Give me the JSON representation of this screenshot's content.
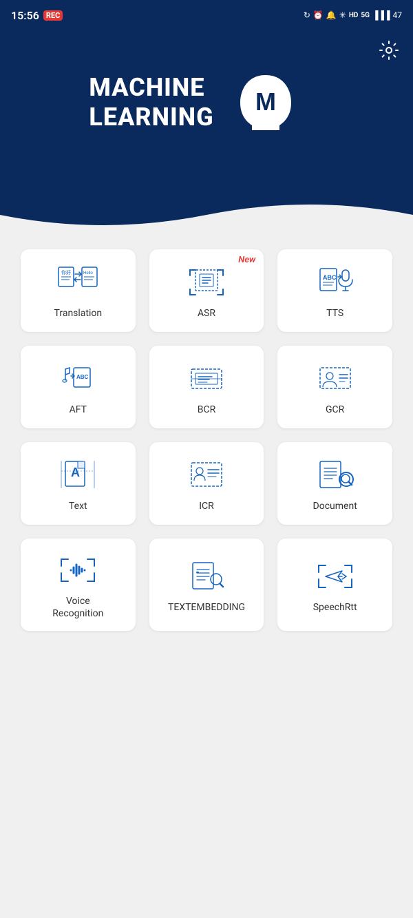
{
  "statusBar": {
    "time": "15:56",
    "recLabel": "REC",
    "batteryLevel": "47"
  },
  "header": {
    "titleLine1": "MACHINE",
    "titleLine2": "LEARNING",
    "settingsIcon": "⚙",
    "fullTitle": "MACHINE LEARNING"
  },
  "grid": {
    "items": [
      {
        "id": "translation",
        "label": "Translation",
        "isNew": false
      },
      {
        "id": "asr",
        "label": "ASR",
        "isNew": true
      },
      {
        "id": "tts",
        "label": "TTS",
        "isNew": false
      },
      {
        "id": "aft",
        "label": "AFT",
        "isNew": false
      },
      {
        "id": "bcr",
        "label": "BCR",
        "isNew": false
      },
      {
        "id": "gcr",
        "label": "GCR",
        "isNew": false
      },
      {
        "id": "text",
        "label": "Text",
        "isNew": false
      },
      {
        "id": "icr",
        "label": "ICR",
        "isNew": false
      },
      {
        "id": "document",
        "label": "Document",
        "isNew": false
      },
      {
        "id": "voice-recognition",
        "label": "Voice\nRecognition",
        "isNew": false
      },
      {
        "id": "textembedding",
        "label": "TEXTEMBEDDING",
        "isNew": false
      },
      {
        "id": "speechrtt",
        "label": "SpeechRtt",
        "isNew": false
      }
    ],
    "newBadge": "New"
  },
  "colors": {
    "primary": "#0a2a5e",
    "accent": "#1565c0",
    "new": "#e53935",
    "cardBg": "#ffffff",
    "pageBg": "#f0f0f0"
  }
}
